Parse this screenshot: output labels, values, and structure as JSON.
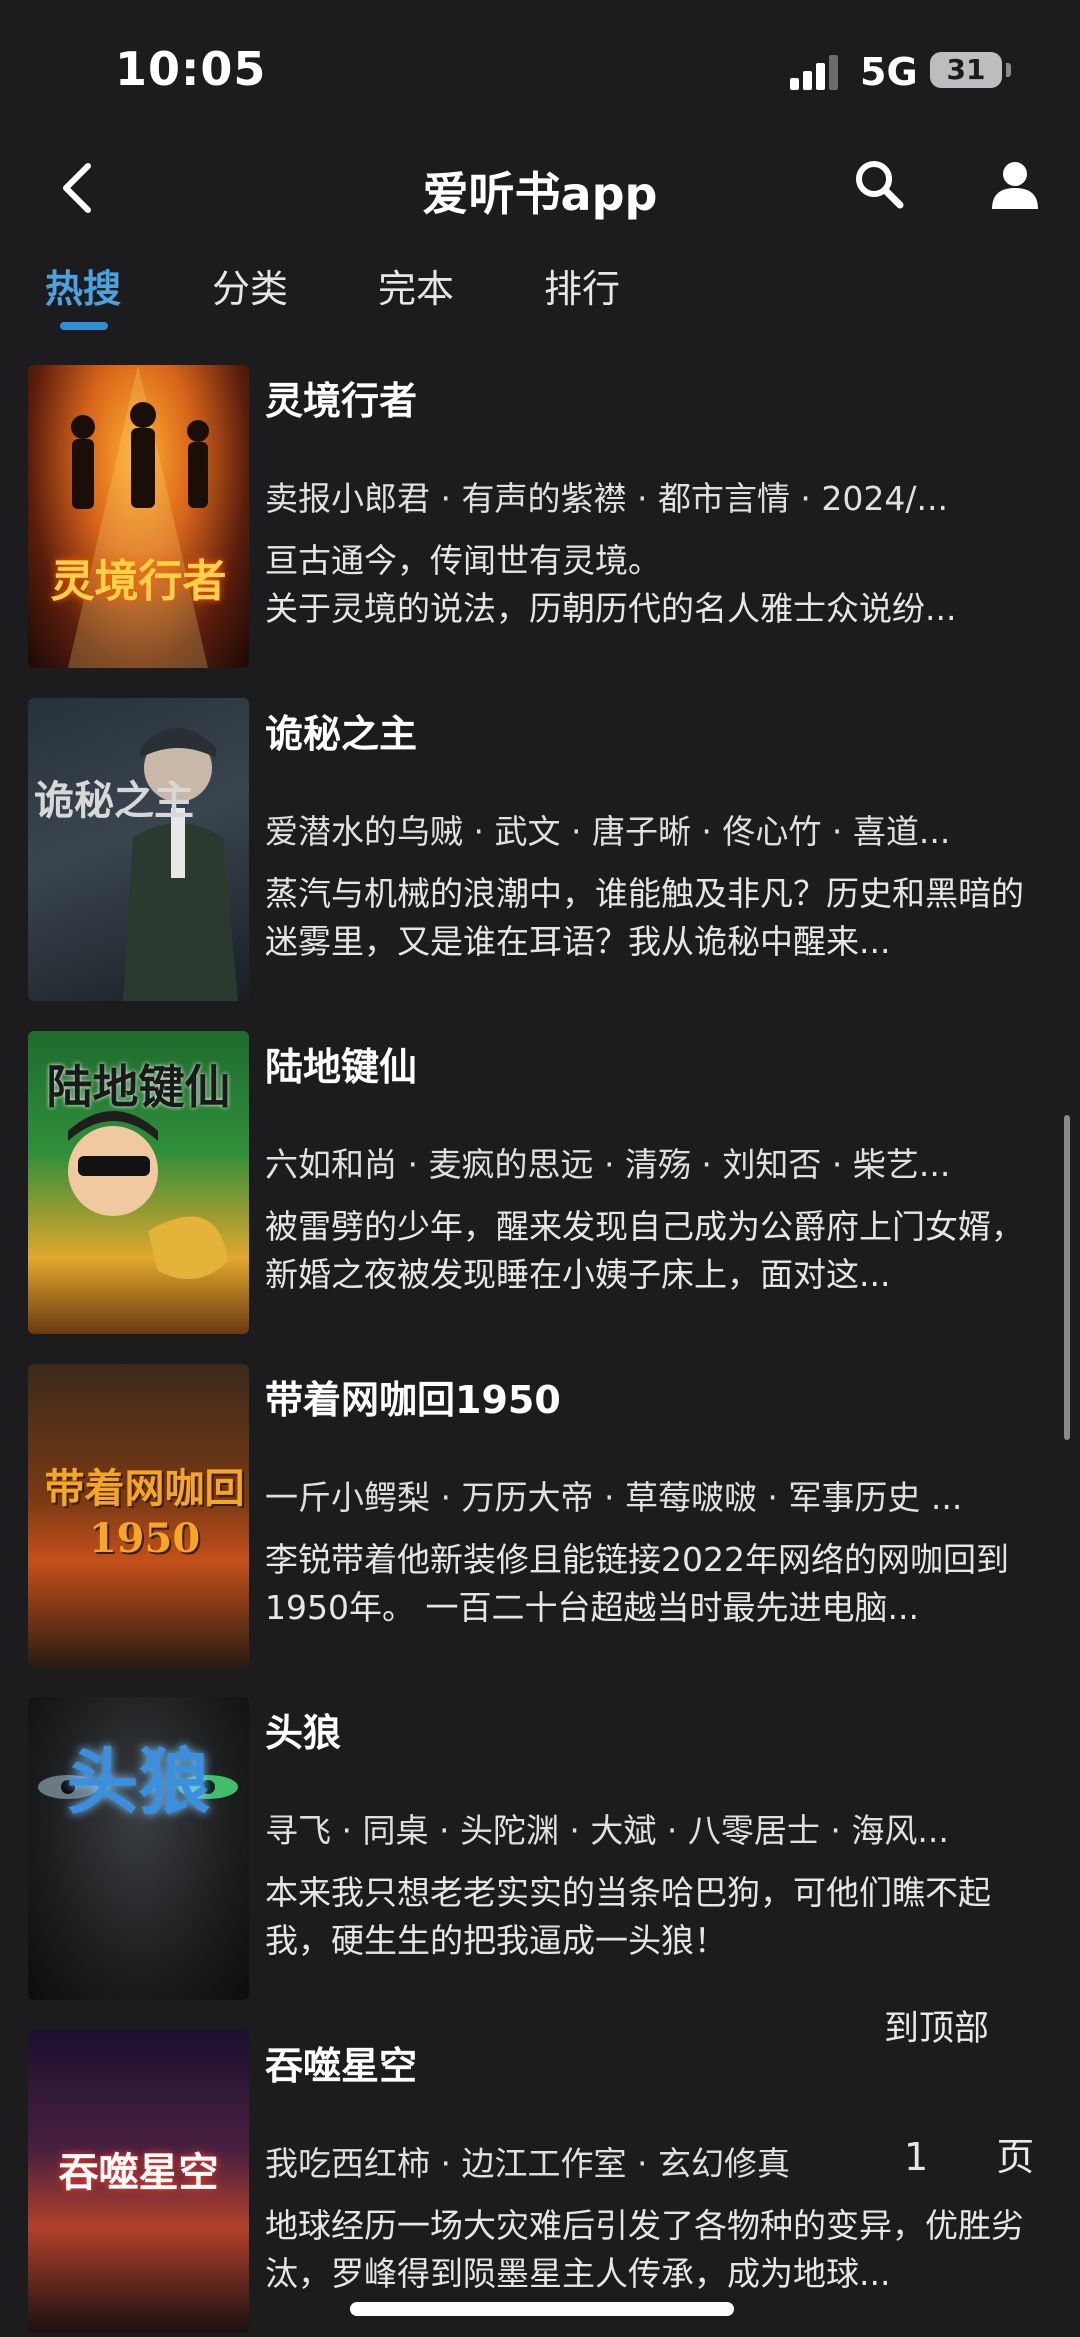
{
  "status_bar": {
    "time": "10:05",
    "network": "5G",
    "battery": "31"
  },
  "header": {
    "title": "爱听书app"
  },
  "tabs": [
    {
      "label": "热搜",
      "active": true
    },
    {
      "label": "分类",
      "active": false
    },
    {
      "label": "完本",
      "active": false
    },
    {
      "label": "排行",
      "active": false
    }
  ],
  "books": [
    {
      "title": "灵境行者",
      "meta": "卖报小郎君 · 有声的紫襟 · 都市言情 · 2024/...",
      "description": "亘古通今，传闻世有灵境。\n关于灵境的说法，历朝历代的名人雅士众说纷...",
      "cover_text": "灵境行者"
    },
    {
      "title": "诡秘之主",
      "meta": "爱潜水的乌贼 · 武文 · 唐子晰 · 佟心竹 · 喜道...",
      "description": "蒸汽与机械的浪潮中，谁能触及非凡？历史和黑暗的迷雾里，又是谁在耳语？我从诡秘中醒来...",
      "cover_text": "诡秘之主"
    },
    {
      "title": "陆地键仙",
      "meta": "六如和尚 · 麦疯的思远 · 清殇 · 刘知否 · 柴艺...",
      "description": "被雷劈的少年，醒来发现自己成为公爵府上门女婿，新婚之夜被发现睡在小姨子床上，面对这...",
      "cover_text": "陆地键仙"
    },
    {
      "title": "带着网咖回1950",
      "meta": "一斤小鳄梨 · 万历大帝 · 草莓啵啵 · 军事历史 ...",
      "description": "李锐带着他新装修且能链接2022年网络的网咖回到1950年。 一百二十台超越当时最先进电脑...",
      "cover_text": "带着网咖回1950"
    },
    {
      "title": "头狼",
      "meta": "寻飞 · 同桌 · 头陀渊 · 大斌 · 八零居士 · 海风...",
      "description": "本来我只想老老实实的当条哈巴狗，可他们瞧不起我，硬生生的把我逼成一头狼！",
      "cover_text": "头狼"
    },
    {
      "title": "吞噬星空",
      "meta": "我吃西红柿 · 边江工作室 · 玄幻修真",
      "description": "地球经历一场大灾难后引发了各物种的变异，优胜劣汰，罗峰得到陨墨星主人传承，成为地球...",
      "cover_text": "吞噬星空"
    }
  ],
  "floating": {
    "to_top": "到顶部",
    "page": "1 页"
  },
  "colors": {
    "background": "#1c1c1e",
    "accent": "#4aa3df"
  }
}
